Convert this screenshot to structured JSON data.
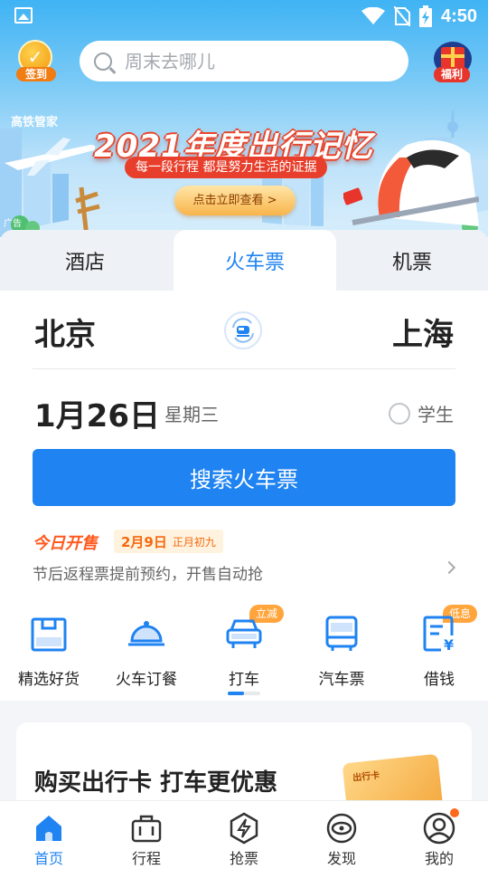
{
  "status_bar": {
    "time": "4:50"
  },
  "header": {
    "signin_label": "签到",
    "search_placeholder": "周末去哪儿",
    "welfare_label": "福利"
  },
  "banner": {
    "brand": "高铁管家",
    "title": "2021年度出行记忆",
    "subtitle": "每一段行程 都是努力生活的证据",
    "button": "点击立即查看 >",
    "ad_tag": "广告"
  },
  "booking_tabs": [
    {
      "label": "酒店"
    },
    {
      "label": "火车票"
    },
    {
      "label": "机票"
    }
  ],
  "booking": {
    "from_city": "北京",
    "to_city": "上海",
    "date": "1月26日",
    "weekday": "星期三",
    "student_label": "学生",
    "search_button": "搜索火车票"
  },
  "presale": {
    "tag": "今日开售",
    "date": "2月9日",
    "lunar": "正月初九",
    "description": "节后返程票提前预约，开售自动抢"
  },
  "quick_actions": [
    {
      "label": "精选好货",
      "icon": "bag-icon"
    },
    {
      "label": "火车订餐",
      "icon": "food-cloche-icon"
    },
    {
      "label": "打车",
      "icon": "car-icon",
      "badge": "立减"
    },
    {
      "label": "汽车票",
      "icon": "bus-icon"
    },
    {
      "label": "借钱",
      "icon": "loan-icon",
      "badge": "低息"
    }
  ],
  "promo": {
    "title": "购买出行卡  打车更优惠",
    "card_label": "出行卡"
  },
  "tab_bar": [
    {
      "label": "首页",
      "icon": "home-icon",
      "active": true
    },
    {
      "label": "行程",
      "icon": "suitcase-icon"
    },
    {
      "label": "抢票",
      "icon": "lightning-icon"
    },
    {
      "label": "发现",
      "icon": "discover-icon"
    },
    {
      "label": "我的",
      "icon": "profile-icon",
      "has_dot": true
    }
  ],
  "colors": {
    "primary": "#1f83f2",
    "orange": "#ffa53c",
    "hot": "#ff5a1f"
  }
}
